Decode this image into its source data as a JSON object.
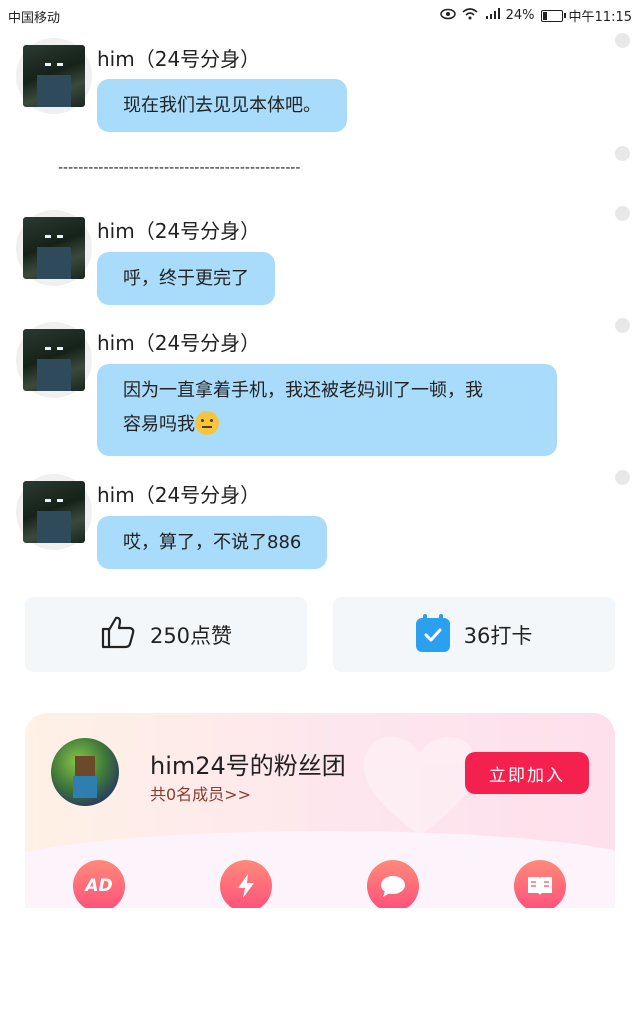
{
  "status_bar": {
    "carrier": "中国移动",
    "network": "4G",
    "battery": "24%",
    "time": "中午11:15"
  },
  "messages": [
    {
      "author": "him（24号分身）",
      "text": "现在我们去见见本体吧。"
    },
    {
      "author": "him（24号分身）",
      "text": "呼，终于更完了"
    },
    {
      "author": "him（24号分身）",
      "text_line1": "因为一直拿着手机，我还被老妈训了一顿，我",
      "text_line2": "容易吗我"
    },
    {
      "author": "him（24号分身）",
      "text": "哎，算了，不说了886"
    }
  ],
  "divider": "------------------------------------------------",
  "actions": {
    "like_label": "250点赞",
    "checkin_label": "36打卡"
  },
  "fan_group": {
    "title": "him24号的粉丝团",
    "members": "共0名成员>>",
    "join_label": "立即加入",
    "features": [
      "AD",
      "flash-icon",
      "chat-icon",
      "book-icon"
    ]
  },
  "colors": {
    "bubble": "#a8dcfa",
    "join_button": "#f4214f",
    "checkin_icon": "#2ba0ef"
  }
}
